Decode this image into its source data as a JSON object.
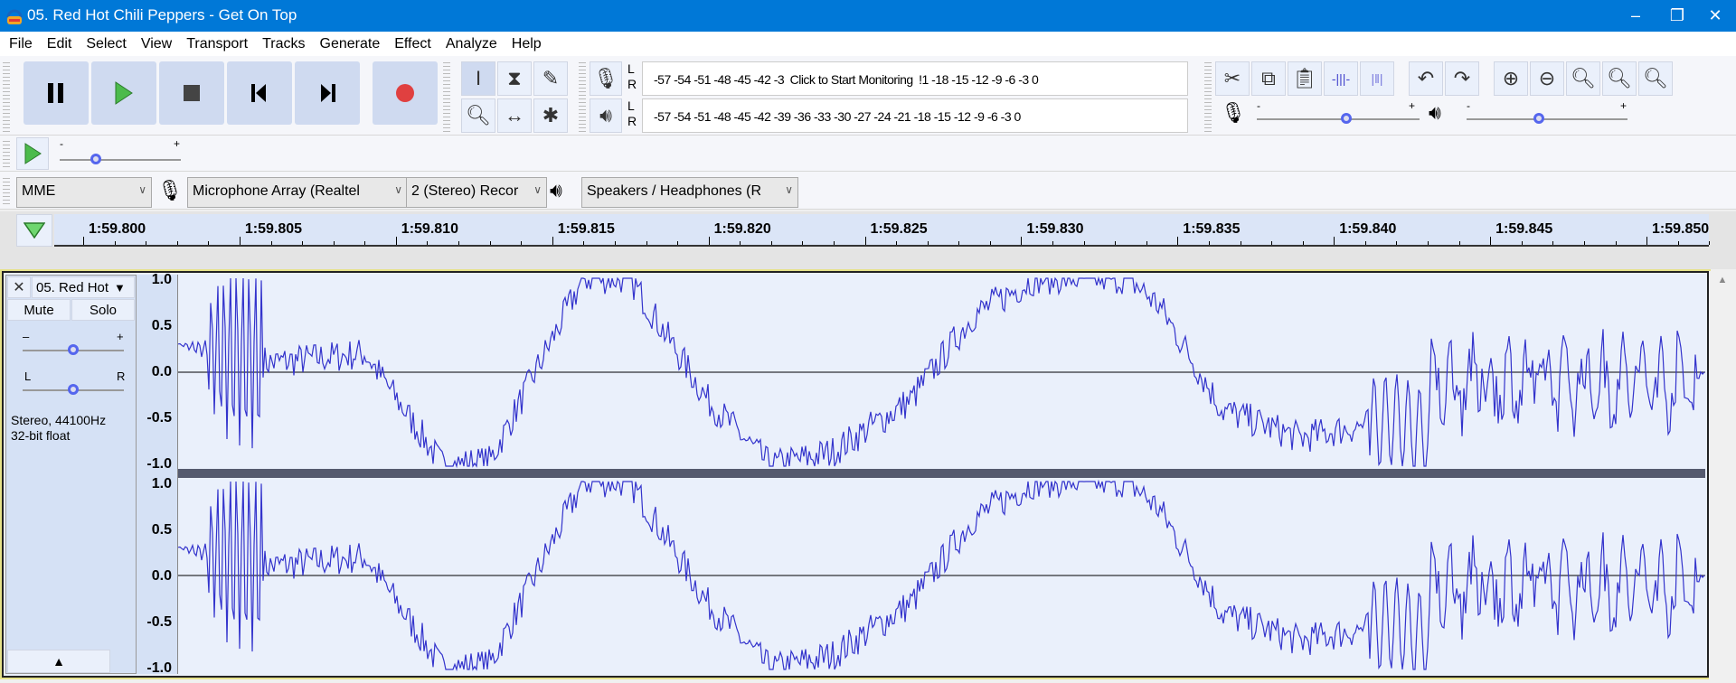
{
  "window": {
    "title": "05. Red Hot Chili Peppers - Get On Top",
    "minimize": "–",
    "restore": "❐",
    "close": "✕"
  },
  "menu": [
    "File",
    "Edit",
    "Select",
    "View",
    "Transport",
    "Tracks",
    "Generate",
    "Effect",
    "Analyze",
    "Help"
  ],
  "transport": {
    "pause": "pause-icon",
    "play": "play-icon",
    "stop": "stop-icon",
    "skip_start": "skip-start-icon",
    "skip_end": "skip-end-icon",
    "record": "record-icon"
  },
  "meters": {
    "record_scale": "-57 -54 -51 -48 -45 -42 -3",
    "record_tail": "!1 -18 -15 -12  -9   -6   -3   0",
    "monitor_prompt": "Click to Start Monitoring",
    "play_scale": "-57 -54 -51 -48 -45 -42 -39 -36 -33 -30 -27 -24 -21 -18 -15 -12  -9   -6   -3   0",
    "L": "L",
    "R": "R"
  },
  "sliders": {
    "minus": "-",
    "plus": "+",
    "play_speed": 0.3,
    "record_volume": 0.55,
    "playback_volume": 0.45
  },
  "devices": {
    "host": "MME",
    "input": "Microphone Array (Realtel",
    "channels": "2 (Stereo) Recor",
    "output": "Speakers / Headphones (R"
  },
  "timeline": {
    "labels": [
      "1:59.800",
      "1:59.805",
      "1:59.810",
      "1:59.815",
      "1:59.820",
      "1:59.825",
      "1:59.830",
      "1:59.835",
      "1:59.840",
      "1:59.845",
      "1:59.850"
    ]
  },
  "track": {
    "name": "05. Red Hot",
    "close": "✕",
    "mute": "Mute",
    "solo": "Solo",
    "gain_minus": "–",
    "gain_plus": "+",
    "pan_left": "L",
    "pan_right": "R",
    "gain": 0.5,
    "pan": 0.5,
    "info1": "Stereo, 44100Hz",
    "info2": "32-bit float",
    "collapse": "▲",
    "scale": [
      "1.0",
      "0.5",
      "0.0",
      "-0.5",
      "-1.0"
    ]
  },
  "colors": {
    "titlebar": "#0078d7",
    "waveform": "#3333cc",
    "record": "#e04040",
    "play": "#4cbb4c"
  }
}
